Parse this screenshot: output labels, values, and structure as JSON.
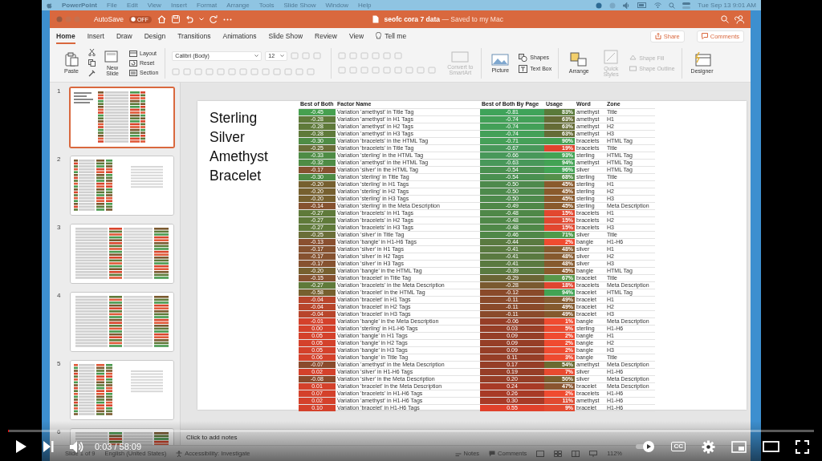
{
  "menu_bar": {
    "app": "PowerPoint",
    "items": [
      "File",
      "Edit",
      "View",
      "Insert",
      "Format",
      "Arrange",
      "Tools",
      "Slide Show",
      "Window",
      "Help"
    ],
    "clock": "Tue Sep 13 9:01 AM"
  },
  "window": {
    "autosave": {
      "label": "AutoSave",
      "state": "OFF",
      "on": false
    },
    "title": "**seofc cora 7 data** — Saved to my Mac"
  },
  "tabs": [
    {
      "label": "Home",
      "selected": true
    },
    {
      "label": "Insert",
      "selected": false
    },
    {
      "label": "Draw",
      "selected": false
    },
    {
      "label": "Design",
      "selected": false
    },
    {
      "label": "Transitions",
      "selected": false
    },
    {
      "label": "Animations",
      "selected": false
    },
    {
      "label": "Slide Show",
      "selected": false
    },
    {
      "label": "Review",
      "selected": false
    },
    {
      "label": "View",
      "selected": false
    }
  ],
  "tell_me": "Tell me",
  "share": "Share",
  "comments": "Comments",
  "ribbon": {
    "paste": {
      "label": "Paste",
      "disabled": false
    },
    "new_slide": {
      "label": "New Slide",
      "disabled": false
    },
    "layout": {
      "label": "Layout",
      "disabled": false
    },
    "reset": {
      "label": "Reset",
      "disabled": false
    },
    "section": {
      "label": "Section",
      "disabled": false
    },
    "font": "Calibri (Body)",
    "font_size": "12",
    "convert": {
      "label": "Convert to SmartArt",
      "disabled": true
    },
    "picture": {
      "label": "Picture",
      "disabled": false
    },
    "shapes": {
      "label": "Shapes",
      "disabled": false
    },
    "text_box": {
      "label": "Text Box",
      "disabled": false
    },
    "arrange": {
      "label": "Arrange",
      "disabled": false
    },
    "quick_styles": {
      "label": "Quick Styles",
      "disabled": true
    },
    "shape_fill": {
      "label": "Shape Fill",
      "disabled": true
    },
    "shape_outline": {
      "label": "Shape Outline",
      "disabled": true
    },
    "designer": {
      "label": "Designer",
      "disabled": false
    }
  },
  "thumbnails": [
    {
      "number": "1",
      "selected": true
    },
    {
      "number": "2",
      "selected": false
    },
    {
      "number": "3",
      "selected": false
    },
    {
      "number": "4",
      "selected": false
    },
    {
      "number": "5",
      "selected": false
    },
    {
      "number": "6",
      "selected": false
    }
  ],
  "slide": {
    "title": "Sterling Silver Amethyst Bracelet",
    "table": {
      "columns": [
        "Best of Both",
        "Factor Name",
        "Best of Both By Page",
        "Usage",
        "Word",
        "Zone"
      ],
      "rows": [
        {
          "best": {
            "text": "-0.45",
            "color": "#46a04f"
          },
          "factor": "Variation 'amethyst' in Title Tag",
          "by_page": {
            "text": "-0.81",
            "color": "#3fa35a"
          },
          "usage": {
            "text": "83%",
            "color": "#5a7a3a"
          },
          "word": "amethyst",
          "zone": "Title"
        },
        {
          "best": {
            "text": "-0.28",
            "color": "#5f7a3a"
          },
          "factor": "Variation 'amethyst' in H1 Tags",
          "by_page": {
            "text": "-0.74",
            "color": "#43a058"
          },
          "usage": {
            "text": "63%",
            "color": "#656c36"
          },
          "word": "amethyst",
          "zone": "H1"
        },
        {
          "best": {
            "text": "-0.28",
            "color": "#5f7a3a"
          },
          "factor": "Variation 'amethyst' in H2 Tags",
          "by_page": {
            "text": "-0.74",
            "color": "#43a058"
          },
          "usage": {
            "text": "63%",
            "color": "#656c36"
          },
          "word": "amethyst",
          "zone": "H2"
        },
        {
          "best": {
            "text": "-0.28",
            "color": "#5f7a3a"
          },
          "factor": "Variation 'amethyst' in H3 Tags",
          "by_page": {
            "text": "-0.74",
            "color": "#43a058"
          },
          "usage": {
            "text": "63%",
            "color": "#656c36"
          },
          "word": "amethyst",
          "zone": "H3"
        },
        {
          "best": {
            "text": "-0.30",
            "color": "#4e8c45"
          },
          "factor": "Variation 'bracelets' in the HTML Tag",
          "by_page": {
            "text": "-0.71",
            "color": "#45a058"
          },
          "usage": {
            "text": "90%",
            "color": "#44a052"
          },
          "word": "bracelets",
          "zone": "HTML Tag"
        },
        {
          "best": {
            "text": "-0.25",
            "color": "#6a6e38"
          },
          "factor": "Variation 'bracelets' in Title Tag",
          "by_page": {
            "text": "-0.67",
            "color": "#48985a"
          },
          "usage": {
            "text": "19%",
            "color": "#e0432d"
          },
          "word": "bracelets",
          "zone": "Title"
        },
        {
          "best": {
            "text": "-0.33",
            "color": "#4e8c45"
          },
          "factor": "Variation 'sterling' in the HTML Tag",
          "by_page": {
            "text": "-0.66",
            "color": "#48985a"
          },
          "usage": {
            "text": "93%",
            "color": "#42a354"
          },
          "word": "sterling",
          "zone": "HTML Tag"
        },
        {
          "best": {
            "text": "-0.32",
            "color": "#4e8c45"
          },
          "factor": "Variation 'amethyst' in the HTML Tag",
          "by_page": {
            "text": "-0.63",
            "color": "#48985a"
          },
          "usage": {
            "text": "94%",
            "color": "#42a354"
          },
          "word": "amethyst",
          "zone": "HTML Tag"
        },
        {
          "best": {
            "text": "-0.17",
            "color": "#865230"
          },
          "factor": "Variation 'silver' in the HTML Tag",
          "by_page": {
            "text": "-0.54",
            "color": "#4a9050"
          },
          "usage": {
            "text": "96%",
            "color": "#42a354"
          },
          "word": "silver",
          "zone": "HTML Tag"
        },
        {
          "best": {
            "text": "-0.30",
            "color": "#4e8c45"
          },
          "factor": "Variation 'sterling' in Title Tag",
          "by_page": {
            "text": "-0.54",
            "color": "#4a9050"
          },
          "usage": {
            "text": "68%",
            "color": "#55904a"
          },
          "word": "sterling",
          "zone": "Title"
        },
        {
          "best": {
            "text": "-0.20",
            "color": "#76602f"
          },
          "factor": "Variation 'sterling' in H1 Tags",
          "by_page": {
            "text": "-0.50",
            "color": "#4d8a4c"
          },
          "usage": {
            "text": "45%",
            "color": "#8a5a2c"
          },
          "word": "sterling",
          "zone": "H1"
        },
        {
          "best": {
            "text": "-0.20",
            "color": "#76602f"
          },
          "factor": "Variation 'sterling' in H2 Tags",
          "by_page": {
            "text": "-0.50",
            "color": "#4d8a4c"
          },
          "usage": {
            "text": "45%",
            "color": "#8a5a2c"
          },
          "word": "sterling",
          "zone": "H2"
        },
        {
          "best": {
            "text": "-0.20",
            "color": "#76602f"
          },
          "factor": "Variation 'sterling' in H3 Tags",
          "by_page": {
            "text": "-0.50",
            "color": "#4d8a4c"
          },
          "usage": {
            "text": "45%",
            "color": "#8a5a2c"
          },
          "word": "sterling",
          "zone": "H3"
        },
        {
          "best": {
            "text": "-0.14",
            "color": "#865230"
          },
          "factor": "Variation 'sterling' in the Meta Description",
          "by_page": {
            "text": "-0.49",
            "color": "#4f8848"
          },
          "usage": {
            "text": "45%",
            "color": "#8a5a2c"
          },
          "word": "sterling",
          "zone": "Meta Description"
        },
        {
          "best": {
            "text": "-0.27",
            "color": "#5f7a3a"
          },
          "factor": "Variation 'bracelets' in H1 Tags",
          "by_page": {
            "text": "-0.48",
            "color": "#4f8848"
          },
          "usage": {
            "text": "15%",
            "color": "#e2472f"
          },
          "word": "bracelets",
          "zone": "H1"
        },
        {
          "best": {
            "text": "-0.27",
            "color": "#5f7a3a"
          },
          "factor": "Variation 'bracelets' in H2 Tags",
          "by_page": {
            "text": "-0.48",
            "color": "#4f8848"
          },
          "usage": {
            "text": "15%",
            "color": "#e2472f"
          },
          "word": "bracelets",
          "zone": "H2"
        },
        {
          "best": {
            "text": "-0.27",
            "color": "#5f7a3a"
          },
          "factor": "Variation 'bracelets' in H3 Tags",
          "by_page": {
            "text": "-0.48",
            "color": "#4f8848"
          },
          "usage": {
            "text": "15%",
            "color": "#e2472f"
          },
          "word": "bracelets",
          "zone": "H3"
        },
        {
          "best": {
            "text": "-0.25",
            "color": "#6a6e38"
          },
          "factor": "Variation 'silver' in Title Tag",
          "by_page": {
            "text": "-0.46",
            "color": "#4f8848"
          },
          "usage": {
            "text": "71%",
            "color": "#4f9a4a"
          },
          "word": "silver",
          "zone": "Title"
        },
        {
          "best": {
            "text": "-0.13",
            "color": "#8a5030"
          },
          "factor": "Variation 'bangle' in H1-H6 Tags",
          "by_page": {
            "text": "-0.44",
            "color": "#5a7a40"
          },
          "usage": {
            "text": "2%",
            "color": "#f04b30"
          },
          "word": "bangle",
          "zone": "H1-H6"
        },
        {
          "best": {
            "text": "-0.17",
            "color": "#865230"
          },
          "factor": "Variation 'silver' in H1 Tags",
          "by_page": {
            "text": "-0.41",
            "color": "#5a7a40"
          },
          "usage": {
            "text": "48%",
            "color": "#865a2e"
          },
          "word": "silver",
          "zone": "H1"
        },
        {
          "best": {
            "text": "-0.17",
            "color": "#865230"
          },
          "factor": "Variation 'silver' in H2 Tags",
          "by_page": {
            "text": "-0.41",
            "color": "#5a7a40"
          },
          "usage": {
            "text": "48%",
            "color": "#865a2e"
          },
          "word": "silver",
          "zone": "H2"
        },
        {
          "best": {
            "text": "-0.17",
            "color": "#865230"
          },
          "factor": "Variation 'silver' in H3 Tags",
          "by_page": {
            "text": "-0.41",
            "color": "#5a7a40"
          },
          "usage": {
            "text": "48%",
            "color": "#865a2e"
          },
          "word": "silver",
          "zone": "H3"
        },
        {
          "best": {
            "text": "-0.20",
            "color": "#76602f"
          },
          "factor": "Variation 'bangle' in the HTML Tag",
          "by_page": {
            "text": "-0.39",
            "color": "#5a7a40"
          },
          "usage": {
            "text": "45%",
            "color": "#8a5a2c"
          },
          "word": "bangle",
          "zone": "HTML Tag"
        },
        {
          "best": {
            "text": "-0.15",
            "color": "#865230"
          },
          "factor": "Variation 'bracelet' in Title Tag",
          "by_page": {
            "text": "-0.29",
            "color": "#6a6535"
          },
          "usage": {
            "text": "67%",
            "color": "#58984a"
          },
          "word": "bracelet",
          "zone": "Title"
        },
        {
          "best": {
            "text": "-0.27",
            "color": "#5f7a3a"
          },
          "factor": "Variation 'bracelets' in the Meta Description",
          "by_page": {
            "text": "-0.28",
            "color": "#7a5a30"
          },
          "usage": {
            "text": "18%",
            "color": "#e04530"
          },
          "word": "bracelets",
          "zone": "Meta Description"
        },
        {
          "best": {
            "text": "-0.58",
            "color": "#76602f"
          },
          "factor": "Variation 'bracelet' in the HTML Tag",
          "by_page": {
            "text": "-0.12",
            "color": "#8a4a2a"
          },
          "usage": {
            "text": "94%",
            "color": "#42a354"
          },
          "word": "bracelet",
          "zone": "HTML Tag"
        },
        {
          "best": {
            "text": "-0.04",
            "color": "#b8452b"
          },
          "factor": "Variation 'bracelet' in H1 Tags",
          "by_page": {
            "text": "-0.11",
            "color": "#8a4a2a"
          },
          "usage": {
            "text": "49%",
            "color": "#845a2e"
          },
          "word": "bracelet",
          "zone": "H1"
        },
        {
          "best": {
            "text": "-0.04",
            "color": "#b8452b"
          },
          "factor": "Variation 'bracelet' in H2 Tags",
          "by_page": {
            "text": "-0.11",
            "color": "#8a4a2a"
          },
          "usage": {
            "text": "49%",
            "color": "#845a2e"
          },
          "word": "bracelet",
          "zone": "H2"
        },
        {
          "best": {
            "text": "-0.04",
            "color": "#b8452b"
          },
          "factor": "Variation 'bracelet' in H3 Tags",
          "by_page": {
            "text": "-0.11",
            "color": "#8a4a2a"
          },
          "usage": {
            "text": "49%",
            "color": "#845a2e"
          },
          "word": "bracelet",
          "zone": "H3"
        },
        {
          "best": {
            "text": "-0.01",
            "color": "#d4412b"
          },
          "factor": "Variation 'bangle' in the Meta Description",
          "by_page": {
            "text": "-0.06",
            "color": "#963e27"
          },
          "usage": {
            "text": "1%",
            "color": "#f04b30"
          },
          "word": "bangle",
          "zone": "Meta Description"
        },
        {
          "best": {
            "text": "0.00",
            "color": "#d4412b"
          },
          "factor": "Variation 'sterling' in H1-H6 Tags",
          "by_page": {
            "text": "0.03",
            "color": "#963e27"
          },
          "usage": {
            "text": "5%",
            "color": "#ea4a30"
          },
          "word": "sterling",
          "zone": "H1-H6"
        },
        {
          "best": {
            "text": "0.05",
            "color": "#d4412b"
          },
          "factor": "Variation 'bangle' in H1 Tags",
          "by_page": {
            "text": "0.09",
            "color": "#963e27"
          },
          "usage": {
            "text": "2%",
            "color": "#f04b30"
          },
          "word": "bangle",
          "zone": "H1"
        },
        {
          "best": {
            "text": "0.05",
            "color": "#d4412b"
          },
          "factor": "Variation 'bangle' in H2 Tags",
          "by_page": {
            "text": "0.09",
            "color": "#963e27"
          },
          "usage": {
            "text": "2%",
            "color": "#f04b30"
          },
          "word": "bangle",
          "zone": "H2"
        },
        {
          "best": {
            "text": "0.05",
            "color": "#d4412b"
          },
          "factor": "Variation 'bangle' in H3 Tags",
          "by_page": {
            "text": "0.09",
            "color": "#963e27"
          },
          "usage": {
            "text": "2%",
            "color": "#f04b30"
          },
          "word": "bangle",
          "zone": "H3"
        },
        {
          "best": {
            "text": "0.06",
            "color": "#d4412b"
          },
          "factor": "Variation 'bangle' in Title Tag",
          "by_page": {
            "text": "0.11",
            "color": "#963e27"
          },
          "usage": {
            "text": "3%",
            "color": "#ee4a30"
          },
          "word": "bangle",
          "zone": "Title"
        },
        {
          "best": {
            "text": "-0.07",
            "color": "#8a4a2c"
          },
          "factor": "Variation 'amethyst' in the Meta Description",
          "by_page": {
            "text": "0.17",
            "color": "#963e27"
          },
          "usage": {
            "text": "54%",
            "color": "#6a6a30"
          },
          "word": "amethyst",
          "zone": "Meta Description"
        },
        {
          "best": {
            "text": "0.02",
            "color": "#d4412b"
          },
          "factor": "Variation 'silver' in H1-H6 Tags",
          "by_page": {
            "text": "0.19",
            "color": "#963e27"
          },
          "usage": {
            "text": "7%",
            "color": "#e84a30"
          },
          "word": "silver",
          "zone": "H1-H6"
        },
        {
          "best": {
            "text": "-0.08",
            "color": "#8a4a2c"
          },
          "factor": "Variation 'silver' in the Meta Description",
          "by_page": {
            "text": "0.20",
            "color": "#963e27"
          },
          "usage": {
            "text": "50%",
            "color": "#7a5e2e"
          },
          "word": "silver",
          "zone": "Meta Description"
        },
        {
          "best": {
            "text": "0.01",
            "color": "#d4412b"
          },
          "factor": "Variation 'bracelet' in the Meta Description",
          "by_page": {
            "text": "0.24",
            "color": "#a83a26"
          },
          "usage": {
            "text": "47%",
            "color": "#8a5530"
          },
          "word": "bracelet",
          "zone": "Meta Description"
        },
        {
          "best": {
            "text": "0.07",
            "color": "#d4412b"
          },
          "factor": "Variation 'bracelets' in H1-H6 Tags",
          "by_page": {
            "text": "0.26",
            "color": "#a83a26"
          },
          "usage": {
            "text": "2%",
            "color": "#f04b30"
          },
          "word": "bracelets",
          "zone": "H1-H6"
        },
        {
          "best": {
            "text": "0.02",
            "color": "#d4412b"
          },
          "factor": "Variation 'amethyst' in H1-H6 Tags",
          "by_page": {
            "text": "0.30",
            "color": "#a83a26"
          },
          "usage": {
            "text": "11%",
            "color": "#e04a30"
          },
          "word": "amethyst",
          "zone": "H1-H6"
        },
        {
          "best": {
            "text": "0.10",
            "color": "#d4412b"
          },
          "factor": "Variation 'bracelet' in H1-H6 Tags",
          "by_page": {
            "text": "0.55",
            "color": "#e0412b"
          },
          "usage": {
            "text": "9%",
            "color": "#e44a30"
          },
          "word": "bracelet",
          "zone": "H1-H6"
        }
      ]
    }
  },
  "notes_placeholder": "Click to add notes",
  "status_bar": {
    "slide": "Slide 1 of 9",
    "language": "English (United States)",
    "accessibility": "Accessibility: Investigate",
    "notes": "Notes",
    "comments": "Comments",
    "zoom": "112%"
  },
  "player": {
    "progress": {
      "level": 0.001
    },
    "time": "0:03 / 58:09",
    "captions": "CC"
  }
}
